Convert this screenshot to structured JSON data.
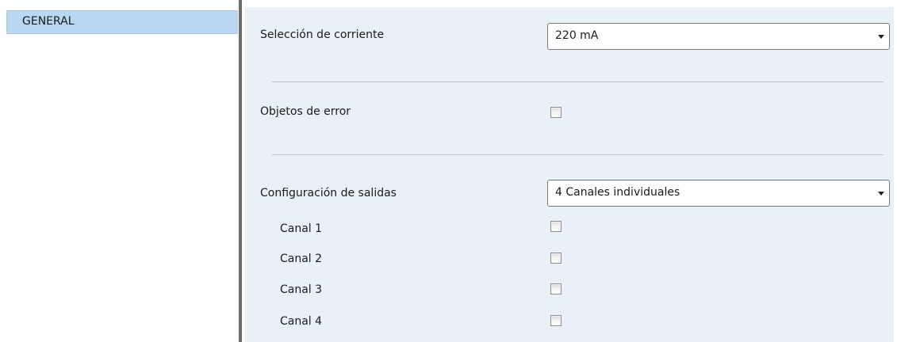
{
  "sidebar": {
    "items": [
      {
        "label": "GENERAL",
        "selected": true
      }
    ]
  },
  "settings": {
    "current_selection": {
      "label": "Selección de corriente",
      "value": "220 mA"
    },
    "error_objects": {
      "label": "Objetos de error",
      "checked": false
    },
    "outputs_configuration": {
      "label": "Configuración de salidas",
      "value": "4 Canales individuales"
    },
    "channels": [
      {
        "label": "Canal 1",
        "checked": false
      },
      {
        "label": "Canal 2",
        "checked": false
      },
      {
        "label": "Canal 3",
        "checked": false
      },
      {
        "label": "Canal 4",
        "checked": false
      }
    ]
  },
  "colors": {
    "selected_nav_background": "#b9d7f3",
    "panel_background": "#e9f0f7",
    "splitter": "#6c6c6c"
  }
}
